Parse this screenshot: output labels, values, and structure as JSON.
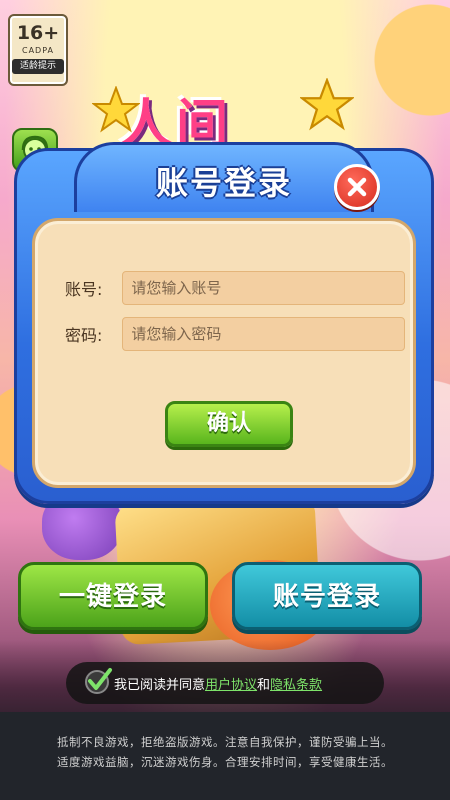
{
  "age_rating": {
    "age": "16+",
    "org": "CADPA",
    "tip": "适龄提示"
  },
  "background_title": "人间",
  "service": {
    "label": "客服"
  },
  "login_dialog": {
    "title": "账号登录",
    "account": {
      "label": "账号:",
      "placeholder": "请您输入账号"
    },
    "password": {
      "label": "密码:",
      "placeholder": "请您输入密码"
    },
    "confirm_label": "确认"
  },
  "buttons": {
    "quick_login": "一键登录",
    "account_login": "账号登录"
  },
  "agreement": {
    "prefix": "我已阅读并同意",
    "user_agreement": "用户协议",
    "and": "和",
    "privacy_policy": "隐私条款",
    "checked": true
  },
  "health_notice": {
    "line1": "抵制不良游戏，拒绝盗版游戏。注意自我保护，谨防受骗上当。",
    "line2": "适度游戏益脑，沉迷游戏伤身。合理安排时间，享受健康生活。"
  },
  "colors": {
    "dialog_blue": "#2f6fe0",
    "dialog_body": "#f7dfb8",
    "confirm_green": "#59b51d",
    "account_teal": "#138ea6",
    "close_red": "#d62c1e",
    "link_green": "#7ee36a"
  }
}
